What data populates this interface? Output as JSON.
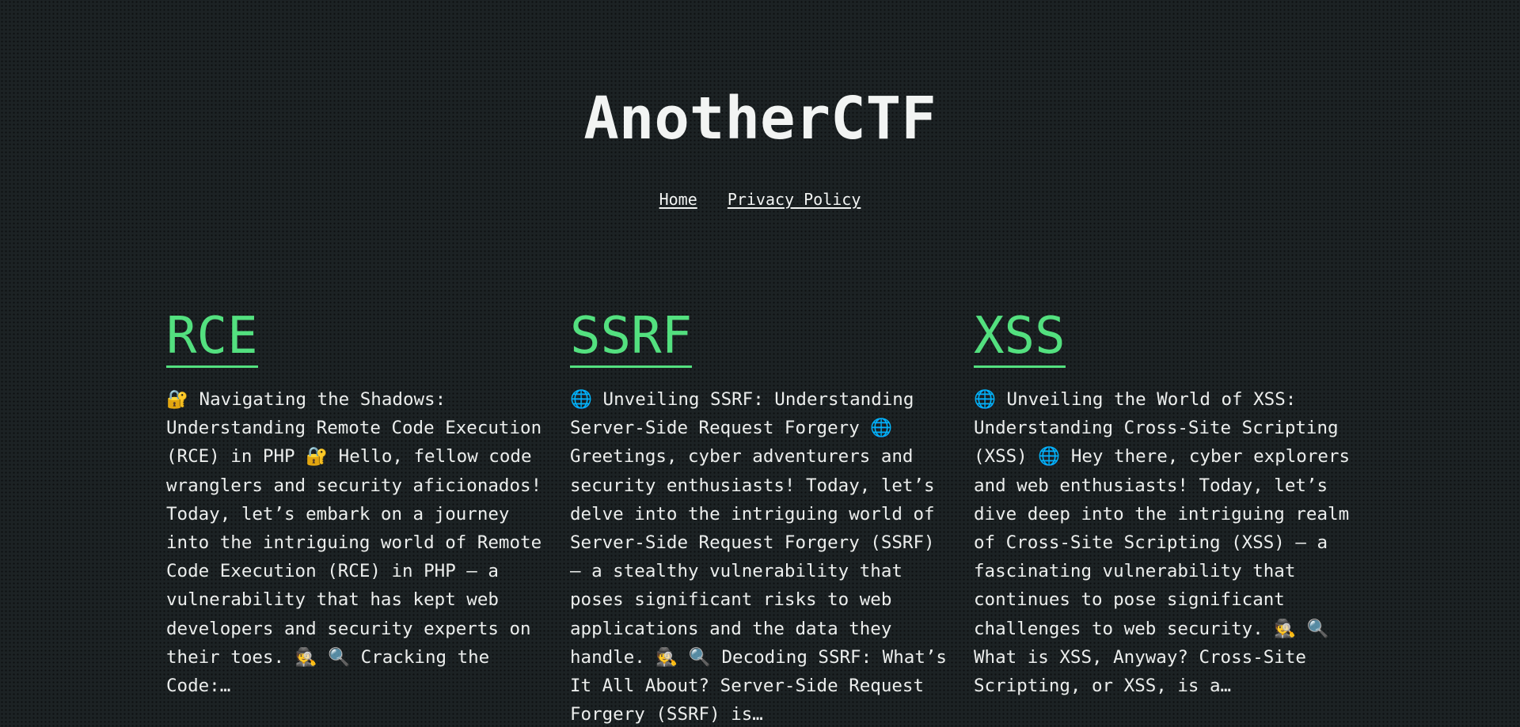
{
  "site": {
    "title": "AnotherCTF"
  },
  "nav": {
    "home": "Home",
    "privacy": "Privacy Policy"
  },
  "posts": [
    {
      "title": "RCE",
      "excerpt": "🔐 Navigating the Shadows: Understanding Remote Code Execution (RCE) in PHP 🔐 Hello, fellow code wranglers and security aficionados! Today, let’s embark on a journey into the intriguing world of Remote Code Execution (RCE) in PHP – a vulnerability that has kept web developers and security experts on their toes. 🕵️ 🔍 Cracking the Code:…"
    },
    {
      "title": "SSRF",
      "excerpt": "🌐 Unveiling SSRF: Understanding Server-Side Request Forgery 🌐 Greetings, cyber adventurers and security enthusiasts! Today, let’s delve into the intriguing world of Server-Side Request Forgery (SSRF) – a stealthy vulnerability that poses significant risks to web applications and the data they handle. 🕵️ 🔍 Decoding SSRF: What’s It All About? Server-Side Request Forgery (SSRF) is…"
    },
    {
      "title": "XSS",
      "excerpt": "🌐 Unveiling the World of XSS: Understanding Cross-Site Scripting (XSS) 🌐 Hey there, cyber explorers and web enthusiasts! Today, let’s dive deep into the intriguing realm of Cross-Site Scripting (XSS) – a fascinating vulnerability that continues to pose significant challenges to web security. 🕵️ 🔍 What is XSS, Anyway? Cross-Site Scripting, or XSS, is a…"
    }
  ]
}
